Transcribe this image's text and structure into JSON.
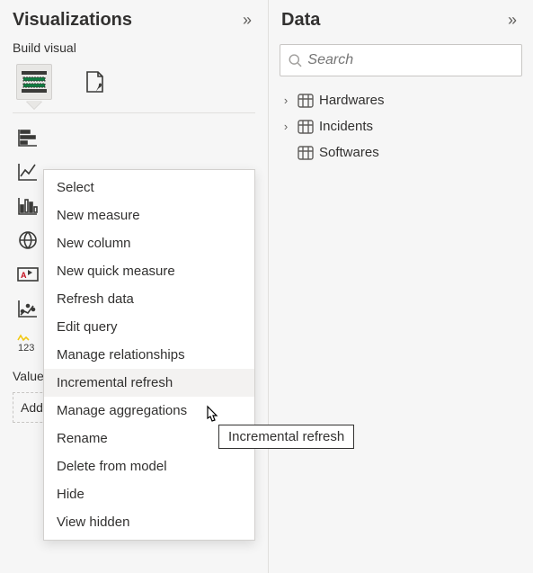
{
  "viz": {
    "title": "Visualizations",
    "subheader": "Build visual",
    "values_label": "Values",
    "add_placeholder": "Add data fields here"
  },
  "data": {
    "title": "Data",
    "search_placeholder": "Search",
    "tables": [
      {
        "name": "Hardwares"
      },
      {
        "name": "Incidents"
      },
      {
        "name": "Softwares"
      }
    ]
  },
  "context_menu": {
    "items": [
      "Select",
      "New measure",
      "New column",
      "New quick measure",
      "Refresh data",
      "Edit query",
      "Manage relationships",
      "Incremental refresh",
      "Manage aggregations",
      "Rename",
      "Delete from model",
      "Hide",
      "View hidden"
    ],
    "hovered_index": 7
  },
  "tooltip": "Incremental refresh"
}
